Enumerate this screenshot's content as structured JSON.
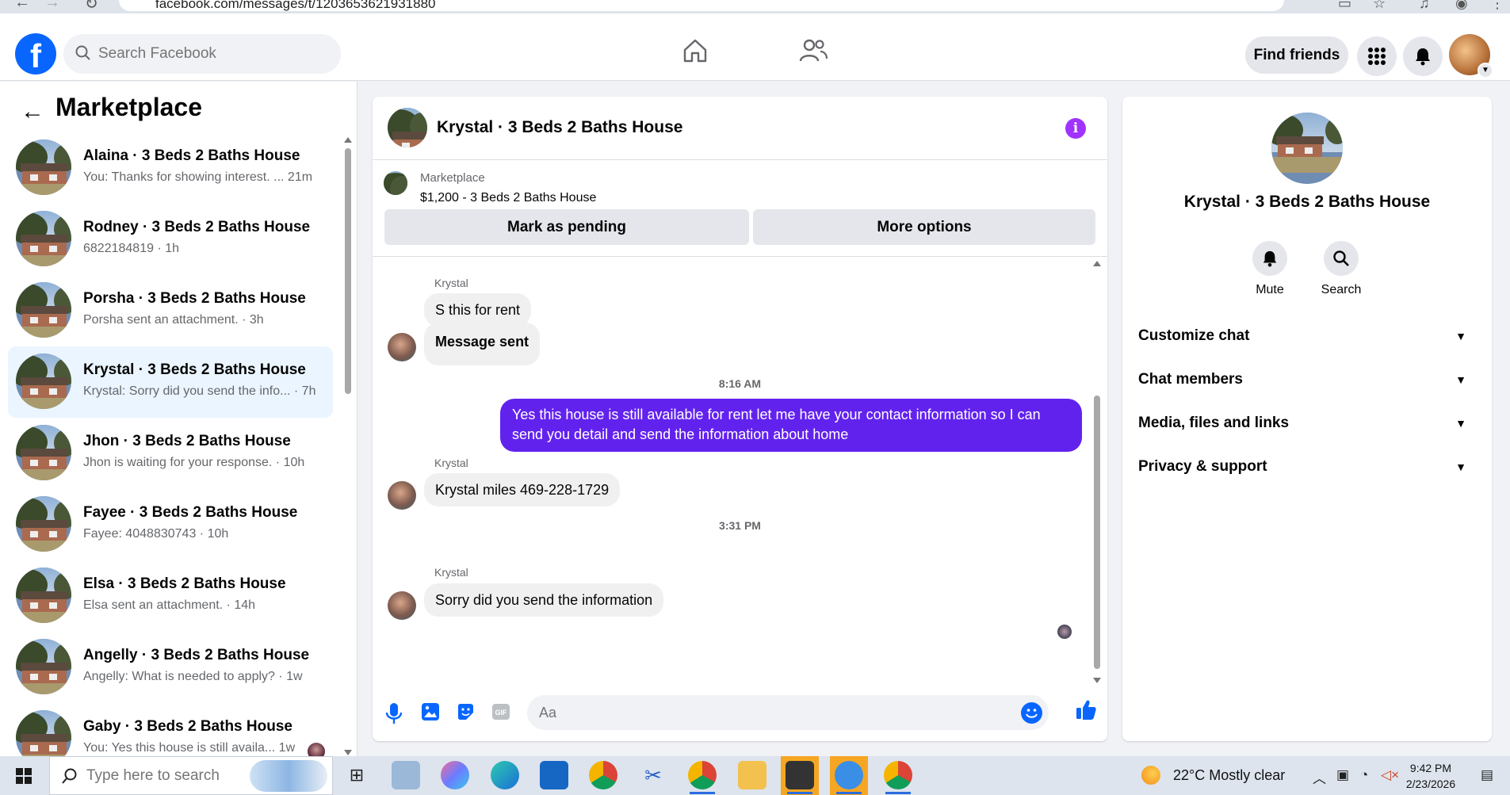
{
  "browser": {
    "url": "facebook.com/messages/t/1203653621931880"
  },
  "header": {
    "search_placeholder": "Search Facebook",
    "find_friends_label": "Find friends"
  },
  "sidebar": {
    "title": "Marketplace",
    "conversations": [
      {
        "name": "Alaina · 3 Beds 2 Baths House",
        "preview": "You: Thanks for showing interest. ...  21m"
      },
      {
        "name": "Rodney · 3 Beds 2 Baths House",
        "preview": "6822184819 · 1h"
      },
      {
        "name": "Porsha · 3 Beds 2 Baths House",
        "preview": "Porsha sent an attachment. · 3h"
      },
      {
        "name": "Krystal · 3 Beds 2 Baths House",
        "preview": "Krystal: Sorry did you send the info... · 7h",
        "active": true
      },
      {
        "name": "Jhon · 3 Beds 2 Baths House",
        "preview": "Jhon is waiting for your response. · 10h"
      },
      {
        "name": "Fayee · 3 Beds 2 Baths House",
        "preview": "Fayee: 4048830743 · 10h"
      },
      {
        "name": "Elsa · 3 Beds 2 Baths House",
        "preview": "Elsa sent an attachment. · 14h"
      },
      {
        "name": "Angelly · 3 Beds 2 Baths House",
        "preview": "Angelly: What is needed to apply? · 1w"
      },
      {
        "name": "Gaby · 3 Beds 2 Baths House",
        "preview": "You: Yes this house is still availa...   1w"
      }
    ]
  },
  "chat": {
    "title": "Krystal · 3 Beds 2 Baths House",
    "marketplace_label": "Marketplace",
    "listing": "$1,200 - 3 Beds 2 Baths House",
    "mark_pending_label": "Mark as pending",
    "more_options_label": "More options",
    "messages": {
      "sender1": "Krystal",
      "m1": "S this for rent",
      "m2": "Message sent",
      "time1": "8:16 AM",
      "m3": "Yes this house is still available for rent let me have your contact information so I can send you detail and send the information about home",
      "sender2": "Krystal",
      "m4": "Krystal miles 469-228-1729",
      "time2": "3:31 PM",
      "sender3": "Krystal",
      "m5": "Sorry did you send the information"
    },
    "composer_placeholder": "Aa",
    "accent_color": "#6222ee"
  },
  "rpanel": {
    "title": "Krystal · 3 Beds 2 Baths House",
    "mute_label": "Mute",
    "search_label": "Search",
    "rows": [
      "Customize chat",
      "Chat members",
      "Media, files and links",
      "Privacy & support"
    ]
  },
  "taskbar": {
    "search_placeholder": "Type here to search",
    "weather": "22°C  Mostly clear",
    "time": "9:42 PM",
    "date": "2/23/2026"
  }
}
